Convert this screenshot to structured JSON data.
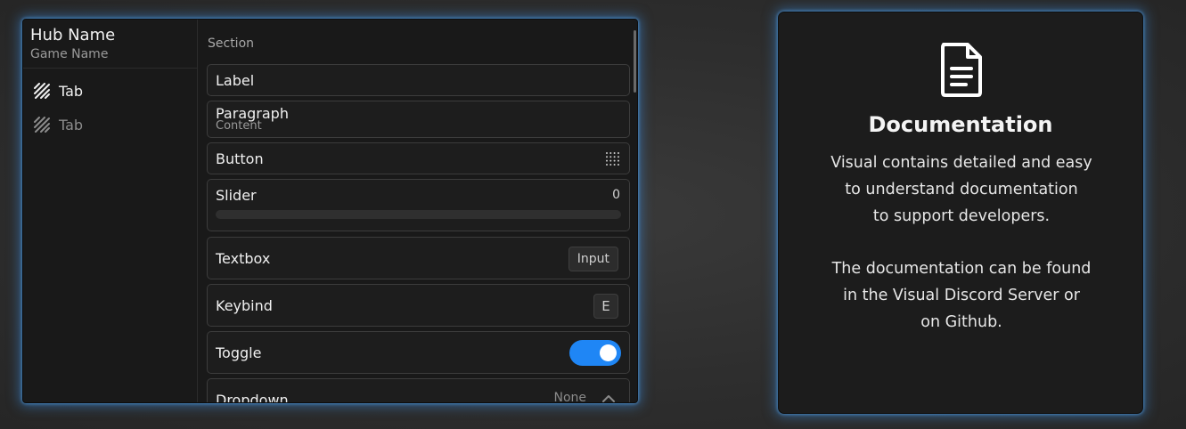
{
  "hub": {
    "name": "Hub Name",
    "game": "Game Name",
    "tabs": [
      {
        "label": "Tab",
        "icon": "stripes-icon",
        "active": true
      },
      {
        "label": "Tab",
        "icon": "stripes-icon",
        "active": false
      }
    ],
    "section": "Section",
    "elements": {
      "label": {
        "label": "Label"
      },
      "paragraph": {
        "label": "Paragraph",
        "content": "Content"
      },
      "button": {
        "label": "Button",
        "icon": "grid-icon"
      },
      "slider": {
        "label": "Slider",
        "value": "0",
        "fill": 0
      },
      "textbox": {
        "label": "Textbox",
        "placeholder": "Input"
      },
      "keybind": {
        "label": "Keybind",
        "key": "E"
      },
      "toggle": {
        "label": "Toggle",
        "on": true
      },
      "dropdown": {
        "label": "Dropdown",
        "value": "None",
        "icon": "chevron-up-icon"
      }
    }
  },
  "doc": {
    "icon": "document-icon",
    "title": "Documentation",
    "lines1": [
      "Visual contains detailed and easy",
      "to understand documentation",
      "to support developers."
    ],
    "lines2": [
      "The documentation can be found",
      "in the Visual Discord Server or",
      "on Github."
    ]
  },
  "colors": {
    "accent": "#1f86f5",
    "glow": "#3c8cdc",
    "panel": "#191919"
  }
}
